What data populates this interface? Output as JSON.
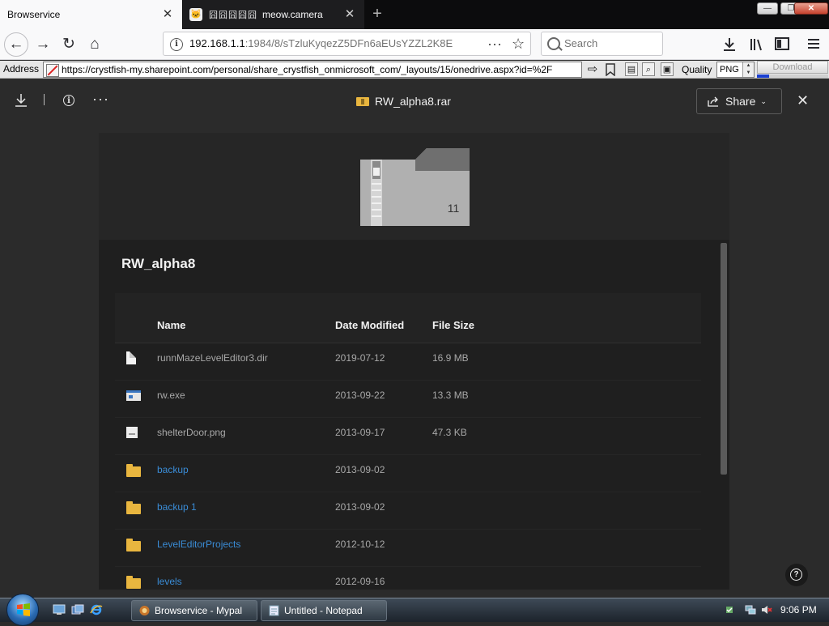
{
  "browser": {
    "tabs": [
      {
        "title": "Browservice",
        "active": true
      },
      {
        "title": "meow.camera",
        "prefix": "囧囧囧囧囧",
        "active": false
      }
    ],
    "new_tab": "+",
    "window_controls": {
      "minimize": "—",
      "maximize": "❐",
      "close": "✕"
    }
  },
  "nav": {
    "back": "←",
    "forward": "→",
    "reload": "↻",
    "home": "⌂",
    "url_host": "192.168.1.1",
    "url_path": ":1984/8/sTzluKyqezZ5DFn6aEUsYZZL2K8E",
    "search_placeholder": "Search",
    "icons": [
      "download-icon",
      "library-icon",
      "sidebar-icon",
      "menu-icon"
    ]
  },
  "addon_bar": {
    "address_label": "Address",
    "address_value": "https://crystfish-my.sharepoint.com/personal/share_crystfish_onmicrosoft_com/_layouts/15/onedrive.aspx?id=%2F",
    "quality_label": "Quality",
    "quality_value": "PNG",
    "download_label": "Download",
    "download_progress": 0.17
  },
  "viewer": {
    "file_title": "RW_alpha8.rar",
    "share_label": "Share",
    "close_glyph": "✕",
    "more_glyph": "···",
    "preview_count": "11",
    "folder_name": "RW_alpha8",
    "columns": {
      "name": "Name",
      "date": "Date Modified",
      "size": "File Size"
    },
    "rows": [
      {
        "icon": "document",
        "name": "runnMazeLevelEditor3.dir",
        "date": "2019-07-12",
        "size": "16.9 MB",
        "is_folder": false
      },
      {
        "icon": "executable",
        "name": "rw.exe",
        "date": "2013-09-22",
        "size": "13.3 MB",
        "is_folder": false
      },
      {
        "icon": "image",
        "name": "shelterDoor.png",
        "date": "2013-09-17",
        "size": "47.3 KB",
        "is_folder": false
      },
      {
        "icon": "folder",
        "name": "backup",
        "date": "2013-09-02",
        "size": "",
        "is_folder": true
      },
      {
        "icon": "folder",
        "name": "backup 1",
        "date": "2013-09-02",
        "size": "",
        "is_folder": true
      },
      {
        "icon": "folder",
        "name": "LevelEditorProjects",
        "date": "2012-10-12",
        "size": "",
        "is_folder": true
      },
      {
        "icon": "folder",
        "name": "levels",
        "date": "2012-09-16",
        "size": "",
        "is_folder": true
      }
    ],
    "help_glyph": "?"
  },
  "taskbar": {
    "buttons": [
      {
        "label": "Browservice - Mypal"
      },
      {
        "label": "Untitled - Notepad"
      }
    ],
    "clock": "9:06 PM"
  },
  "colors": {
    "viewer_bg": "#2b2b2b",
    "link": "#3a8cd6",
    "folder": "#e9b63f"
  }
}
